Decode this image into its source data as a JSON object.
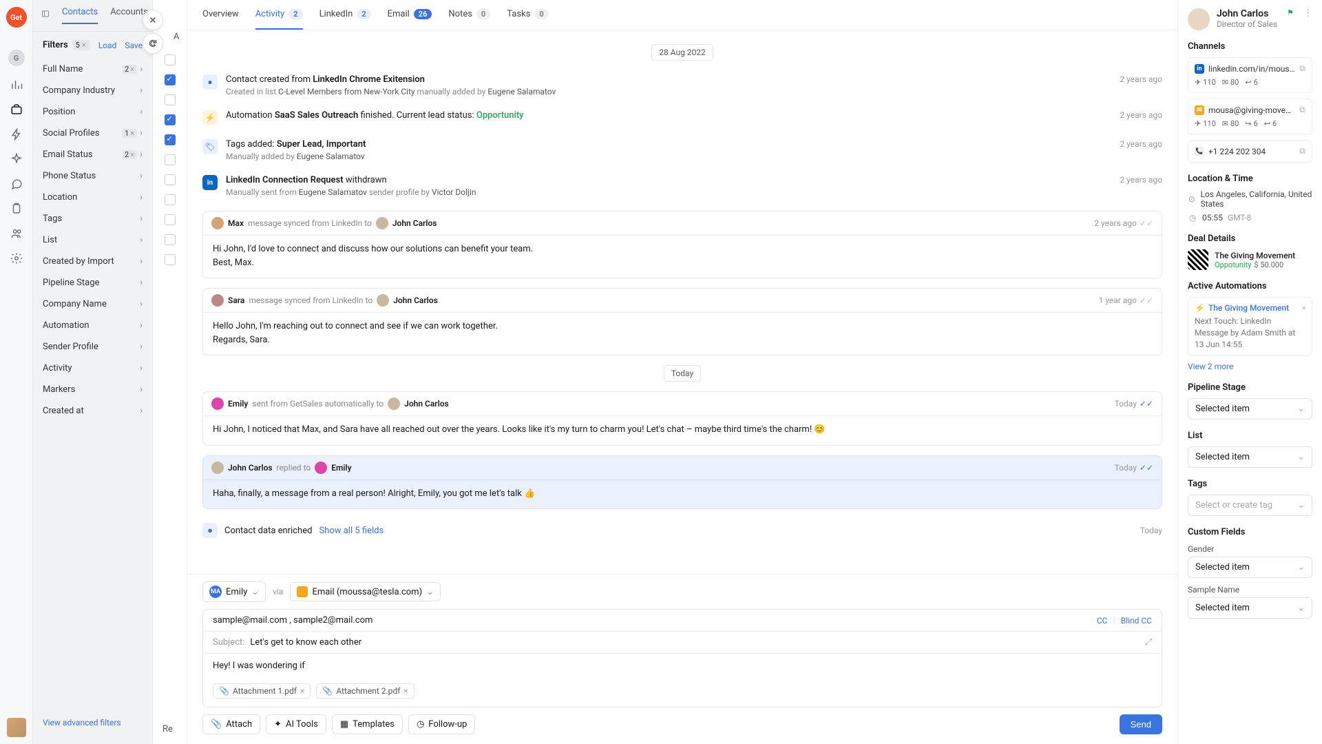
{
  "rail": {
    "logo": "Get",
    "user_initial": "G"
  },
  "topnav": {
    "contacts": "Contacts",
    "accounts": "Accounts"
  },
  "filters": {
    "title": "Filters",
    "count": "5",
    "load": "Load",
    "save": "Save",
    "rows": [
      {
        "label": "Full Name",
        "badge": "2"
      },
      {
        "label": "Company Industry"
      },
      {
        "label": "Position"
      },
      {
        "label": "Social Profiles",
        "badge": "1"
      },
      {
        "label": "Email Status",
        "badge": "2"
      },
      {
        "label": "Phone Status"
      },
      {
        "label": "Location"
      },
      {
        "label": "Tags"
      },
      {
        "label": "List"
      },
      {
        "label": "Created by Import"
      },
      {
        "label": "Pipeline Stage"
      },
      {
        "label": "Company Name"
      },
      {
        "label": "Automation"
      },
      {
        "label": "Sender Profile"
      },
      {
        "label": "Activity"
      },
      {
        "label": "Markers"
      },
      {
        "label": "Created at"
      }
    ],
    "advanced": "View advanced filters"
  },
  "liststrip": {
    "truncated": "A",
    "re": "Re"
  },
  "tabs": [
    {
      "label": "Overview"
    },
    {
      "label": "Activity",
      "count": "2",
      "active": true
    },
    {
      "label": "LinkedIn",
      "count": "2"
    },
    {
      "label": "Email",
      "count": "26",
      "blue": true
    },
    {
      "label": "Notes",
      "count": "0",
      "gray": true
    },
    {
      "label": "Tasks",
      "count": "0",
      "gray": true
    }
  ],
  "feed": {
    "date1": "28 Aug 2022",
    "e1": {
      "pre": "Contact created from ",
      "b": "LinkedIn Chrome Exitension",
      "sub_pre": "Created in list ",
      "sub_list": "C-Level Members from New-York City",
      "sub_mid": " manually added by ",
      "sub_by": "Eugene Salamatov",
      "time": "2 years ago"
    },
    "e2": {
      "pre": "Automation ",
      "b": "SaaS Sales Outreach",
      "post": " finished. Current lead status: ",
      "status": "Opportunity",
      "time": "2 years ago"
    },
    "e3": {
      "pre": "Tags added: ",
      "b": "Super Lead, Important",
      "sub_pre": "Manually added by ",
      "sub_by": "Eugene Salamatov",
      "time": "2 years ago"
    },
    "e4": {
      "b": "LinkedIn Connection Request",
      "post": " withdrawn",
      "sub": "Manually sent from ",
      "sub_by": "Eugene Salamatov",
      "sub2": " sender profile by ",
      "sub2_by": "Victor Doljin",
      "time": "2 years ago"
    },
    "m1": {
      "from": "Max",
      "meta": "message synced from LinkedIn to",
      "to": "John Carlos",
      "time": "2 years ago",
      "body": "Hi John, I'd love to connect and discuss how our solutions can benefit your team.\nBest, Max."
    },
    "m2": {
      "from": "Sara",
      "meta": "message synced from LinkedIn to",
      "to": "John Carlos",
      "time": "1 year ago",
      "body": "Hello John, I'm reaching out to connect and see if we can work together.\nRegards, Sara."
    },
    "date2": "Today",
    "m3": {
      "from": "Emily",
      "meta": "sent from GetSales automatically to",
      "to": "John Carlos",
      "time": "Today",
      "body": "Hi John, I noticed that Max, and Sara have all reached out over the years. Looks like it's my turn to charm you! Let's chat – maybe third time's the charm! 😊"
    },
    "m4": {
      "from": "John Carlos",
      "meta": "replied to",
      "to": "Emily",
      "time": "Today",
      "body": "Haha, finally, a message from a real person! Alright, Emily, you got me let's talk 👍"
    },
    "enrich": {
      "txt": "Contact data enriched",
      "link": "Show all 5 fields",
      "time": "Today"
    }
  },
  "composer": {
    "sender": "Emily",
    "via": "via",
    "channel": "Email (moussa@tesla.com)",
    "to": "sample@mail.com ,  sample2@mail.com",
    "cc": "CC",
    "bcc": "Blind CC",
    "subj_lbl": "Subject:",
    "subj": "Let's get to know each other",
    "body": "Hey! I was wondering if",
    "att1": "Attachment 1.pdf",
    "att2": "Attachment 2.pdf",
    "attach": "Attach",
    "ai": "AI Tools",
    "tpl": "Templates",
    "fu": "Follow-up",
    "send": "Send"
  },
  "profile": {
    "name": "John Carlos",
    "role": "Director of Sales",
    "channels_h": "Channels",
    "ch1": {
      "url": "linkedin.com/in/mousa-antonie",
      "s1": "110",
      "s2": "80",
      "s3": "6"
    },
    "ch2": {
      "url": "mousa@giving-movement.com",
      "s1": "110",
      "s2": "80",
      "s3": "6",
      "s4": "6"
    },
    "ch3": {
      "url": "+1 224 202 304"
    },
    "loc_h": "Location & Time",
    "loc": "Los Angeles, California, United States",
    "time": "05:55",
    "tz": "GMT-8",
    "deal_h": "Deal Details",
    "deal_name": "The Giving Movement",
    "deal_status": "Oppotunity",
    "deal_amt": "$ 50.000",
    "auto_h": "Active Automations",
    "auto_name": "The Giving Movement",
    "auto_desc": "Next Touch: LinkedIn Message by Adam Smith at 13 Jun 14:55",
    "auto_more": "View 2 more",
    "ps_h": "Pipeline Stage",
    "ps_v": "Selected item",
    "list_h": "List",
    "list_v": "Selected item",
    "tags_h": "Tags",
    "tags_ph": "Select or create tag",
    "cf_h": "Custom Fields",
    "gender_h": "Gender",
    "gender_v": "Selected item",
    "sn_h": "Sample Name",
    "sn_v": "Selected item"
  }
}
